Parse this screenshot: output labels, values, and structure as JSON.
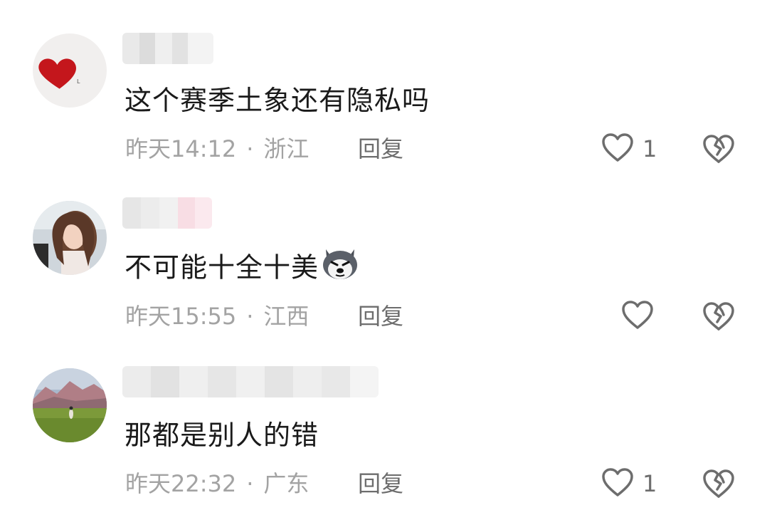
{
  "comments": [
    {
      "text": "这个赛季土象还有隐私吗",
      "time": "昨天14:12",
      "location": "浙江",
      "reply_label": "回复",
      "like_count": "1"
    },
    {
      "text": "不可能十全十美",
      "time": "昨天15:55",
      "location": "江西",
      "reply_label": "回复",
      "like_count": ""
    },
    {
      "text": "那都是别人的错",
      "time": "昨天22:32",
      "location": "广东",
      "reply_label": "回复",
      "like_count": "1"
    }
  ],
  "separator": "·",
  "icons": {
    "like": "heart-outline-icon",
    "dislike": "broken-heart-icon",
    "emoji": "husky-dog-emoji"
  },
  "colors": {
    "text": "#1a1a1a",
    "meta": "#a3a3a3",
    "action": "#6d6d6d"
  }
}
